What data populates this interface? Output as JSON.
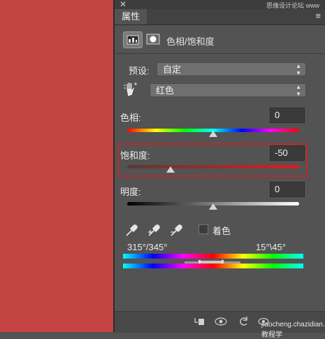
{
  "window": {
    "close_glyph": "✕",
    "watermark": "思缘设计论坛 www"
  },
  "panel": {
    "tab_label": "属性",
    "menu_glyph": "≡",
    "adjustment_title": "色相/饱和度"
  },
  "preset": {
    "label": "预设:",
    "value": "自定"
  },
  "channel": {
    "value": "红色"
  },
  "hue": {
    "label": "色相:",
    "value": "0",
    "slider_fraction": 0.5
  },
  "saturation": {
    "label": "饱和度:",
    "value": "-50",
    "slider_fraction": 0.25
  },
  "lightness": {
    "label": "明度:",
    "value": "0",
    "slider_fraction": 0.5
  },
  "colorize": {
    "label": "着色",
    "checked": false
  },
  "range": {
    "left": "315°/345°",
    "right": "15°\\45°"
  },
  "bottom_watermark": "jiaocheng.chazidian.com  教程学",
  "colors": {
    "canvas": "#c44444",
    "highlight": "#c0272d"
  }
}
